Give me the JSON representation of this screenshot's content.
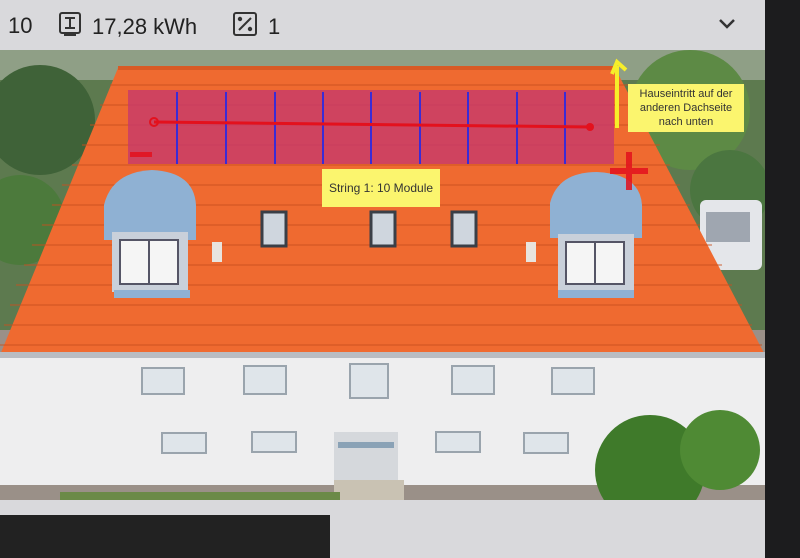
{
  "toolbar": {
    "module_count": "10",
    "energy_icon": "inverter-icon",
    "energy_value": "17,28 kWh",
    "ratio_icon": "percentage-icon",
    "ratio_value": "1",
    "expand_icon": "chevron-down-icon"
  },
  "annotations": {
    "string_label": "String 1: 10 Module",
    "entry_label": "Hauseintritt auf der anderen Dachseite nach unten",
    "minus_symbol": "−",
    "plus_symbol": "+"
  },
  "colors": {
    "toolbar_bg": "#d9d9dc",
    "panel_fill": "#c7396b",
    "panel_grid": "#3a2bd6",
    "string_line": "#e3111d",
    "label_bg": "#fbf56e",
    "entry_arrow": "#f6ee2a"
  },
  "panels": {
    "count": 10
  }
}
